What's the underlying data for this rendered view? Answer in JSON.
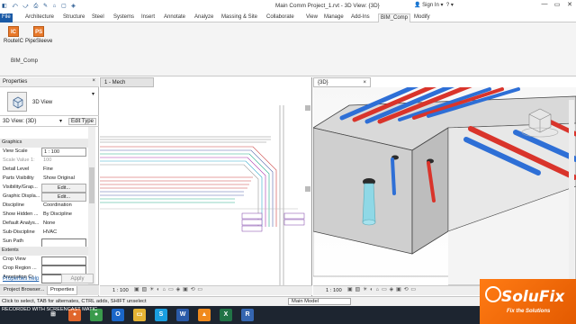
{
  "window": {
    "title": "Main Comm Project_1.rvt - 3D View: {3D}",
    "sign_in": "Sign In",
    "minimize": "—",
    "maximize": "▭",
    "close": "✕"
  },
  "ribbon": {
    "tabs": [
      "File",
      "Architecture",
      "Structure",
      "Steel",
      "Systems",
      "Insert",
      "Annotate",
      "Analyze",
      "Massing & Site",
      "Collaborate",
      "View",
      "Manage",
      "Add-Ins",
      "BIM_Comp",
      "Modify"
    ],
    "active_tab": "BIM_Comp",
    "buttons": [
      {
        "label": "RouteIC",
        "icon_text": "IC"
      },
      {
        "label": "PipeSleeve",
        "icon_text": "PS"
      }
    ],
    "group_label": "BIM_Comp"
  },
  "properties": {
    "header": "Properties",
    "close": "×",
    "type_name": "3D View",
    "selector": "3D View: {3D}",
    "edit_type": "Edit Type",
    "rows": [
      {
        "key": "Graphics",
        "section": true
      },
      {
        "key": "View Scale",
        "value": "1 : 100",
        "box": true
      },
      {
        "key": "Scale Value    1:",
        "value": "100",
        "grey": true
      },
      {
        "key": "Detail Level",
        "value": "Fine"
      },
      {
        "key": "Parts Visibility",
        "value": "Show Original"
      },
      {
        "key": "Visibility/Grap...",
        "value": "Edit...",
        "button": true
      },
      {
        "key": "Graphic Displa...",
        "value": "Edit...",
        "button": true
      },
      {
        "key": "Discipline",
        "value": "Coordination"
      },
      {
        "key": "Show Hidden ...",
        "value": "By Discipline"
      },
      {
        "key": "Default Analys...",
        "value": "None"
      },
      {
        "key": "Sub-Discipline",
        "value": "HVAC"
      },
      {
        "key": "Sun Path",
        "checkbox": true
      },
      {
        "key": "Extents",
        "section": true
      },
      {
        "key": "Crop View",
        "checkbox": true
      },
      {
        "key": "Crop Region ...",
        "checkbox": true
      },
      {
        "key": "Annotation Cr...",
        "checkbox": true
      }
    ],
    "help_link": "Properties help",
    "apply": "Apply",
    "tabs": [
      "Project Browser...",
      "Properties"
    ]
  },
  "views": {
    "mech": {
      "tab": "1 - Mech",
      "scale": "1 : 100"
    },
    "3d": {
      "tab": "{3D}",
      "scale": "1 : 100"
    }
  },
  "status": {
    "hint": "Click to select, TAB for alternates, CTRL adds, SHIFT unselect",
    "model": "Main Model",
    "filter": "0"
  },
  "taskbar": {
    "recorder": "RECORDED WITH  SCREENCAST  MATIC",
    "apps": [
      {
        "name": "windows",
        "color": "#1d2530",
        "text": "⊞"
      },
      {
        "name": "firefox",
        "color": "#e0662c",
        "text": "●"
      },
      {
        "name": "chrome",
        "color": "#3a9b4c",
        "text": "●"
      },
      {
        "name": "outlook",
        "color": "#1a66c8",
        "text": "O"
      },
      {
        "name": "file-explorer",
        "color": "#e6b434",
        "text": "▭"
      },
      {
        "name": "skype",
        "color": "#1a9ee0",
        "text": "S"
      },
      {
        "name": "word",
        "color": "#2a5aa8",
        "text": "W"
      },
      {
        "name": "vlc",
        "color": "#f08a1c",
        "text": "▲"
      },
      {
        "name": "excel",
        "color": "#217346",
        "text": "X"
      },
      {
        "name": "revit",
        "color": "#3566b0",
        "text": "R"
      }
    ]
  },
  "watermark": {
    "name": "SoluFix",
    "tagline": "Fix the Solutions"
  },
  "colors": {
    "accent": "#1a5aa6",
    "pipe_red": "#d9342b",
    "pipe_blue": "#2e6fd6",
    "pipe_cyan": "#8fd8e6"
  }
}
